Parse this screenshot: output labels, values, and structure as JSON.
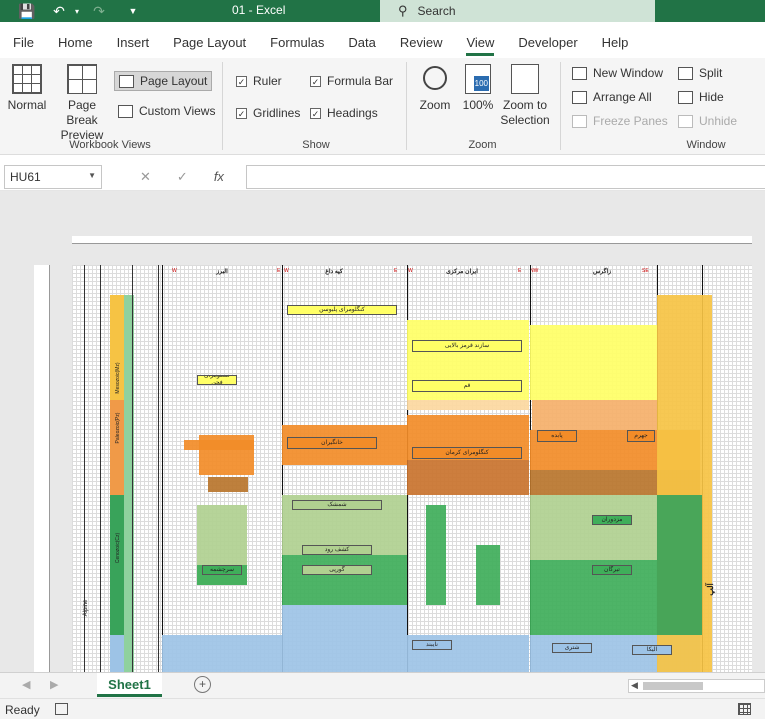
{
  "titlebar": {
    "doc_title": "01  -  Excel",
    "search_placeholder": "Search"
  },
  "menu_tabs": [
    "File",
    "Home",
    "Insert",
    "Page Layout",
    "Formulas",
    "Data",
    "Review",
    "View",
    "Developer",
    "Help"
  ],
  "active_tab": "View",
  "ribbon": {
    "workbook_views": {
      "label": "Workbook Views",
      "normal": "Normal",
      "page_break": "Page Break Preview",
      "page_layout": "Page Layout",
      "custom_views": "Custom Views"
    },
    "show": {
      "label": "Show",
      "ruler": "Ruler",
      "formula_bar": "Formula Bar",
      "gridlines": "Gridlines",
      "headings": "Headings"
    },
    "zoom": {
      "label": "Zoom",
      "zoom": "Zoom",
      "zoom100": "100%",
      "zoom_selection": "Zoom to Selection",
      "zoom100_icon_text": "100"
    },
    "window": {
      "label": "Window",
      "new_window": "New Window",
      "arrange_all": "Arrange All",
      "freeze_panes": "Freeze Panes",
      "split": "Split",
      "hide": "Hide",
      "unhide": "Unhide"
    }
  },
  "formula_bar": {
    "name_box": "HU61",
    "fx": "fx",
    "cancel": "✕",
    "enter": "✓",
    "formula": ""
  },
  "sheet": {
    "regions": [
      "البرز",
      "کپه داغ",
      "ایران مرکزی",
      "زاگرس"
    ],
    "directions": [
      "W",
      "E",
      "W",
      "E",
      "W",
      "E",
      "NW",
      "SE"
    ],
    "left_era_labels": [
      "Paleozoic(Pz)",
      "Cenozoic(Cz)",
      "Mesozoic(Mz)"
    ],
    "left_side_label": "Alpine",
    "right_label": "آلپ",
    "blocks": [
      {
        "t": "کنگلومرای پلیوسن",
        "c": "#ffff66"
      },
      {
        "t": "سازند قرمز بالایی",
        "c": "#ffff66"
      },
      {
        "t": "قم",
        "c": "#ffff66"
      },
      {
        "t": "کنگلومرای فجن",
        "c": "#ffff66"
      },
      {
        "t": "خانگیران",
        "c": "#f28c28"
      },
      {
        "t": "کنگلومرای کرمان",
        "c": "#f28c28"
      },
      {
        "t": "پابده",
        "c": "#f28c28"
      },
      {
        "t": "جهرم",
        "c": "#f28c28"
      },
      {
        "t": "شمشک",
        "c": "#b0d090"
      },
      {
        "t": "مزدوران",
        "c": "#3fae5a"
      },
      {
        "t": "تیرگان",
        "c": "#3fae5a"
      },
      {
        "t": "سرچشمه",
        "c": "#3fae5a"
      },
      {
        "t": "گورپی",
        "c": "#b0d090"
      },
      {
        "t": "کشف رود",
        "c": "#b0d090"
      },
      {
        "t": "نایبند",
        "c": "#9dc3e6"
      },
      {
        "t": "شتری",
        "c": "#9dc3e6"
      },
      {
        "t": "الیکا",
        "c": "#9dc3e6"
      }
    ]
  },
  "sheet_tab": "Sheet1",
  "status": {
    "ready": "Ready"
  }
}
